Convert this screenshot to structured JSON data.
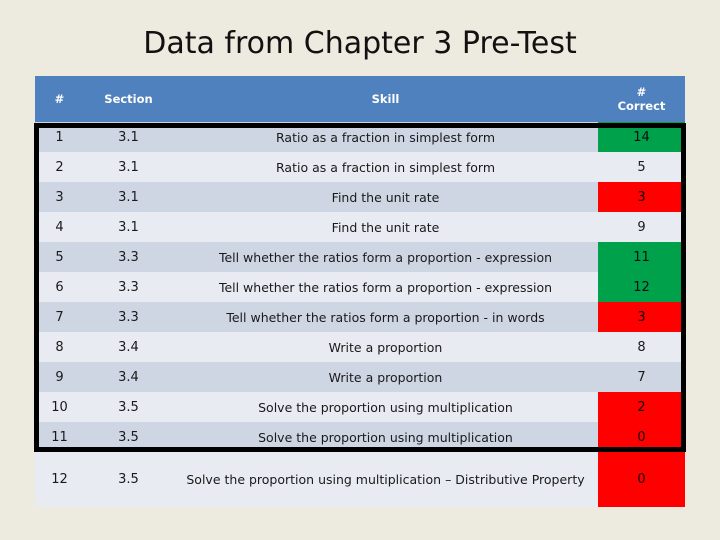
{
  "slide": {
    "title": "Data from Chapter 3 Pre-Test",
    "background_color": "#EDEBE0"
  },
  "table": {
    "header_color": "#4E81BD",
    "band_a_color": "#CED6E4",
    "band_b_color": "#E8EBF2",
    "green_color": "#00A14B",
    "red_color": "#FF0000",
    "emphasis_border_color": "#000000",
    "columns": [
      {
        "key": "num",
        "label": "#"
      },
      {
        "key": "section",
        "label": "Section"
      },
      {
        "key": "skill",
        "label": "Skill"
      },
      {
        "key": "correct",
        "label_line1": "#",
        "label_line2": "Correct"
      }
    ],
    "rows": [
      {
        "num": "1",
        "section": "3.1",
        "skill": "Ratio as a fraction in simplest form",
        "correct": "14",
        "highlight": "green"
      },
      {
        "num": "2",
        "section": "3.1",
        "skill": "Ratio as a fraction in simplest form",
        "correct": "5",
        "highlight": "none"
      },
      {
        "num": "3",
        "section": "3.1",
        "skill": "Find the unit rate",
        "correct": "3",
        "highlight": "red"
      },
      {
        "num": "4",
        "section": "3.1",
        "skill": "Find the unit rate",
        "correct": "9",
        "highlight": "none"
      },
      {
        "num": "5",
        "section": "3.3",
        "skill": "Tell whether the ratios form a proportion - expression",
        "correct": "11",
        "highlight": "green"
      },
      {
        "num": "6",
        "section": "3.3",
        "skill": "Tell whether the ratios form a proportion - expression",
        "correct": "12",
        "highlight": "green"
      },
      {
        "num": "7",
        "section": "3.3",
        "skill": "Tell whether the ratios form a proportion - in words",
        "correct": "3",
        "highlight": "red"
      },
      {
        "num": "8",
        "section": "3.4",
        "skill": "Write a proportion",
        "correct": "8",
        "highlight": "none"
      },
      {
        "num": "9",
        "section": "3.4",
        "skill": "Write a proportion",
        "correct": "7",
        "highlight": "none"
      },
      {
        "num": "10",
        "section": "3.5",
        "skill": "Solve the proportion using multiplication",
        "correct": "2",
        "highlight": "red"
      },
      {
        "num": "11",
        "section": "3.5",
        "skill": "Solve the proportion using multiplication",
        "correct": "0",
        "highlight": "red"
      },
      {
        "num": "12",
        "section": "3.5",
        "skill": "Solve the proportion using multiplication – Distributive Property",
        "correct": "0",
        "highlight": "red"
      }
    ]
  }
}
